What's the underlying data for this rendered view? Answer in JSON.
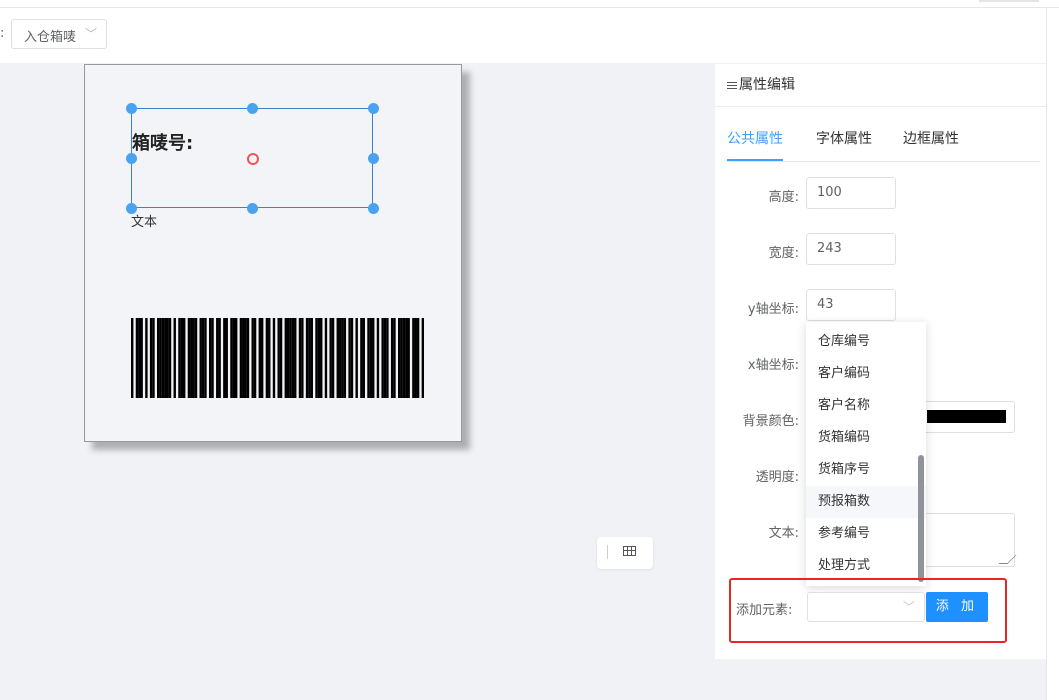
{
  "toolbar": {
    "colon": ":",
    "template_select": "入仓箱唛"
  },
  "canvas": {
    "field_label": "箱唛号:",
    "field_type": "文本",
    "barcode_bars": "1011101011011111101011101111011101101101101110111101101101101011011111011011101110101101111011010110111010111011011111011101"
  },
  "panel": {
    "title": "属性编辑",
    "tabs": [
      {
        "label": "公共属性"
      },
      {
        "label": "字体属性"
      },
      {
        "label": "边框属性"
      }
    ],
    "fields": {
      "height": {
        "label": "高度:",
        "value": "100"
      },
      "width": {
        "label": "宽度:",
        "value": "243"
      },
      "y": {
        "label": "y轴坐标:",
        "value": "43"
      },
      "x": {
        "label": "x轴坐标:"
      },
      "bg_color": {
        "label": "背景颜色:",
        "value": "#000000"
      },
      "opacity": {
        "label": "透明度:"
      },
      "text": {
        "label": "文本:"
      }
    },
    "add_element": {
      "label": "添加元素:",
      "button": "添 加"
    },
    "dropdown_options": [
      "仓库编号",
      "客户编码",
      "客户名称",
      "货箱编码",
      "货箱序号",
      "预报箱数",
      "参考编号",
      "处理方式"
    ],
    "dropdown_hover_index": 5
  },
  "icons": {
    "select_chevron": "chevron-down-icon",
    "title_menu": "menu-bars-icon",
    "table": "table-icon"
  },
  "colors": {
    "accent": "#409eff",
    "button": "#1e90ff",
    "highlight": "#e52727",
    "selection": "#4aa3f0"
  }
}
